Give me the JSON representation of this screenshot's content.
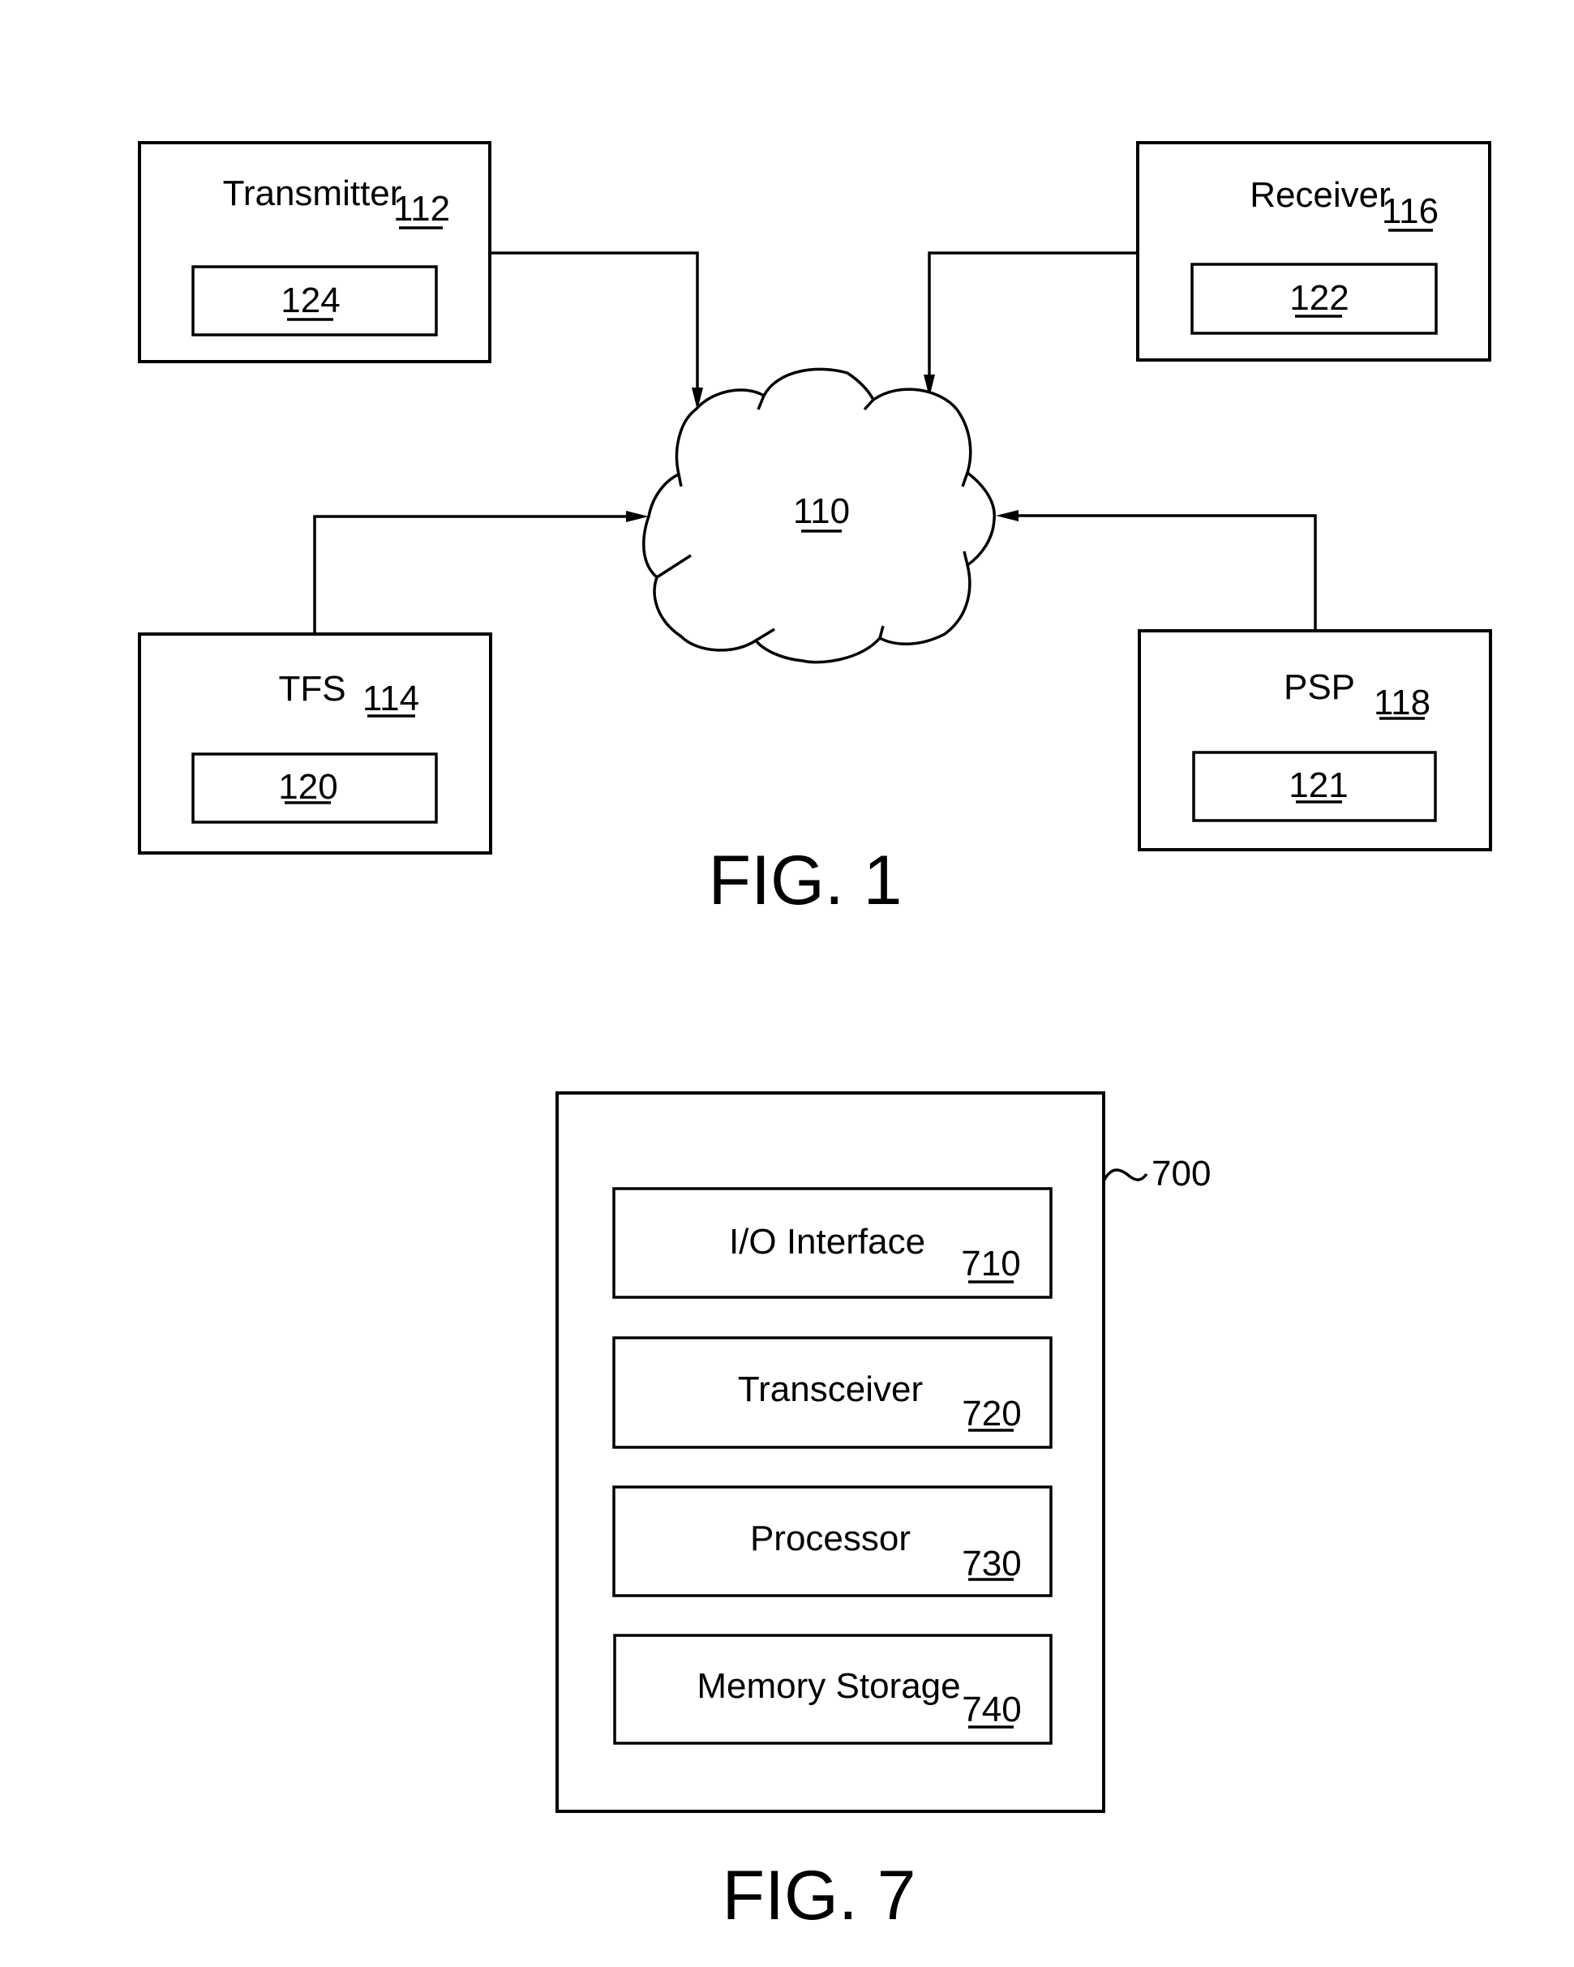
{
  "figure1": {
    "caption": "FIG. 1",
    "network": {
      "ref": "110",
      "shape": "cloud"
    },
    "nodes": [
      {
        "id": "transmitter",
        "label": "Transmitter",
        "ref": "112",
        "inner_ref": "124"
      },
      {
        "id": "receiver",
        "label": "Receiver",
        "ref": "116",
        "inner_ref": "122"
      },
      {
        "id": "tfs",
        "label": "TFS",
        "ref": "114",
        "inner_ref": "120"
      },
      {
        "id": "psp",
        "label": "PSP",
        "ref": "118",
        "inner_ref": "121"
      }
    ],
    "connections": [
      {
        "from": "transmitter",
        "to": "network",
        "direction": "to-network"
      },
      {
        "from": "receiver",
        "to": "network",
        "direction": "to-network"
      },
      {
        "from": "tfs",
        "to": "network",
        "direction": "to-network"
      },
      {
        "from": "psp",
        "to": "network",
        "direction": "to-network"
      }
    ]
  },
  "figure7": {
    "caption": "FIG. 7",
    "device_ref": "~700",
    "components": [
      {
        "label": "I/O Interface",
        "ref": "710"
      },
      {
        "label": "Transceiver",
        "ref": "720"
      },
      {
        "label": "Processor",
        "ref": "730"
      },
      {
        "label": "Memory Storage",
        "ref": "740"
      }
    ]
  }
}
